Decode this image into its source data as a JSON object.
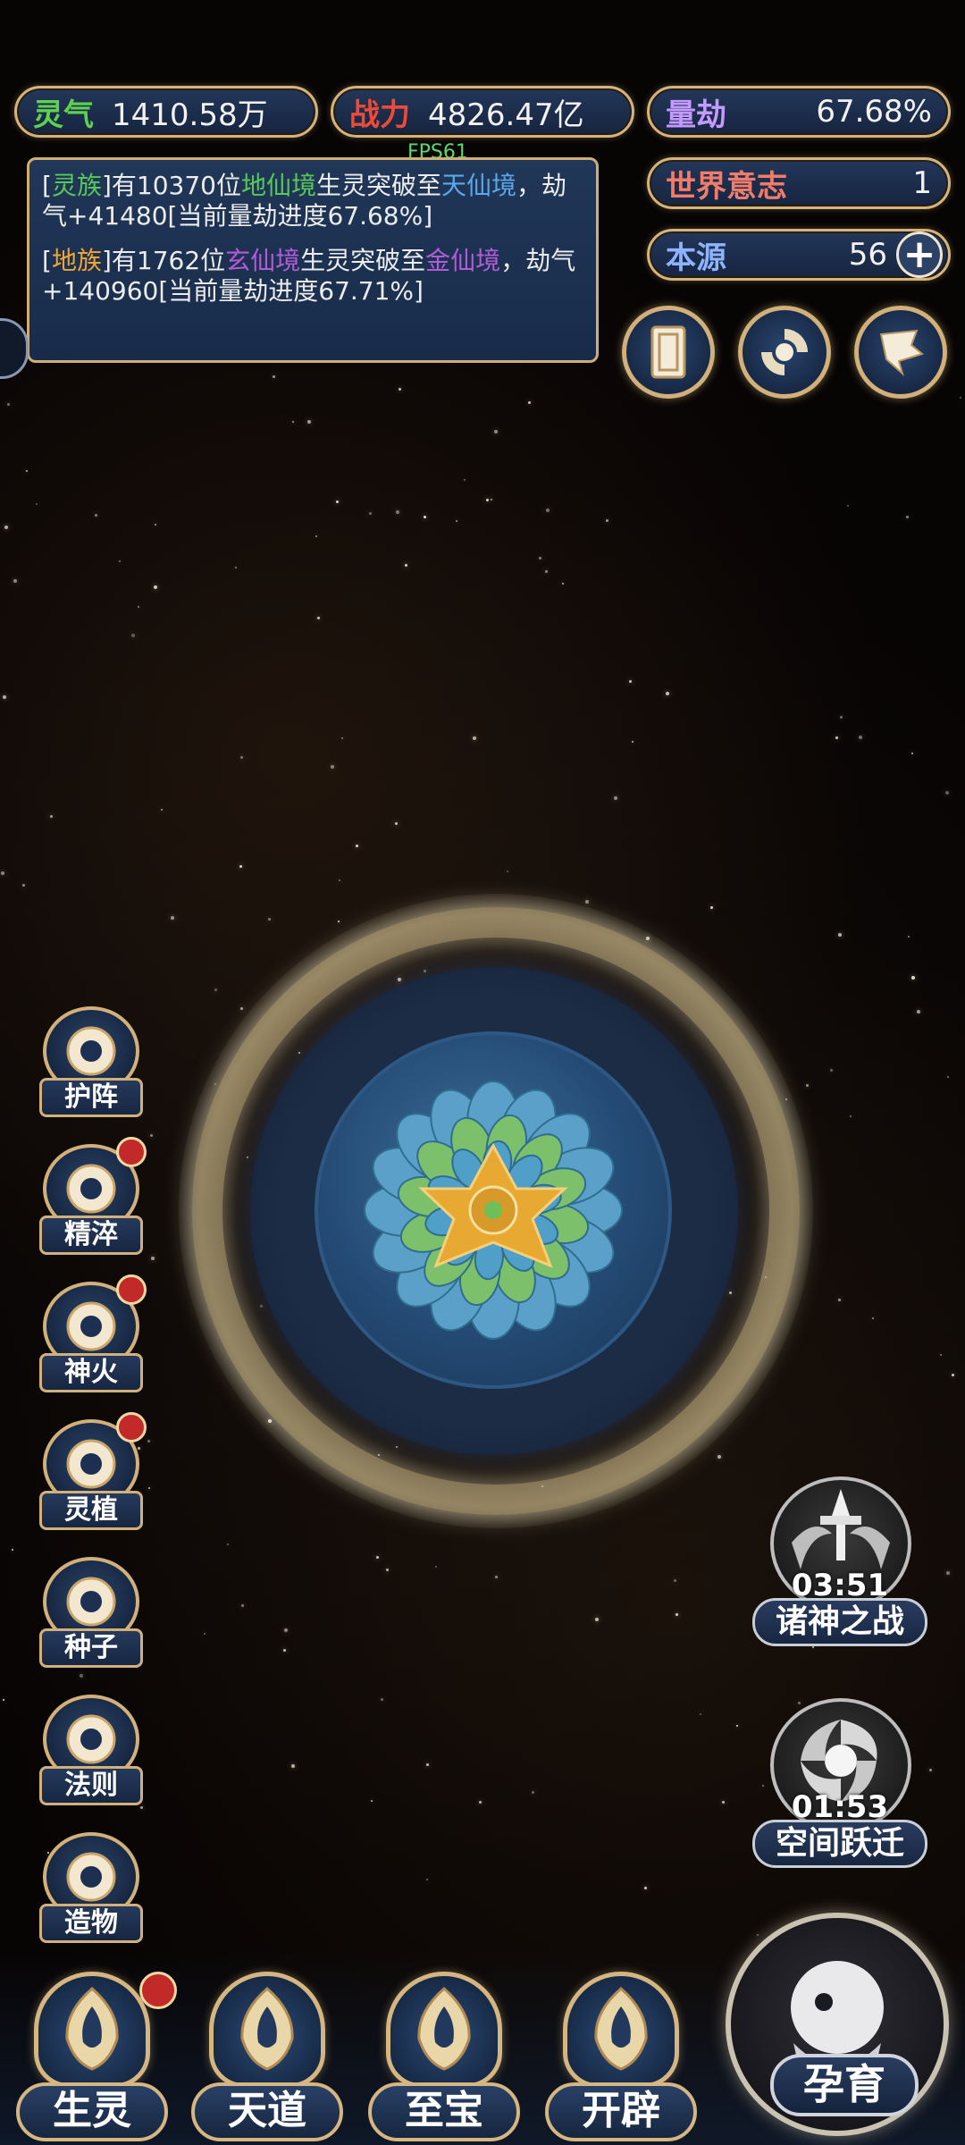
{
  "stats": {
    "lingqi_label": "灵气",
    "lingqi_value": "1410.58万",
    "zhanli_label": "战力",
    "zhanli_value": "4826.47亿",
    "liangjie_label": "量劫",
    "liangjie_value": "67.68%",
    "shijie_label": "世界意志",
    "shijie_value": "1",
    "benyuan_label": "本源",
    "benyuan_value": "56",
    "plus": "+"
  },
  "fps": "FPS61",
  "log": {
    "msg1": {
      "b1": "[",
      "race": "灵族",
      "b2": "]有10370位",
      "from": "地仙境",
      "mid": "生灵突破至",
      "to": "天仙境",
      "rest": "，劫气+41480[当前量劫进度67.68%]"
    },
    "msg2": {
      "b1": "[",
      "race": "地族",
      "b2": "]有1762位",
      "from": "玄仙境",
      "mid": "生灵突破至",
      "to": "金仙境",
      "rest": "，劫气+140960[当前量劫进度67.71%]"
    }
  },
  "top_icons": [
    "card-icon",
    "vortex-icon",
    "flag-icon"
  ],
  "left_menu": [
    {
      "label": "护阵",
      "icon": "taiji-icon",
      "badge": false
    },
    {
      "label": "精淬",
      "icon": "flame-lotus-icon",
      "badge": true
    },
    {
      "label": "神火",
      "icon": "fire-icon",
      "badge": true
    },
    {
      "label": "灵植",
      "icon": "plant-icon",
      "badge": true
    },
    {
      "label": "种子",
      "icon": "seed-icon",
      "badge": false
    },
    {
      "label": "法则",
      "icon": "rule-icon",
      "badge": false
    },
    {
      "label": "造物",
      "icon": "creation-icon",
      "badge": false
    }
  ],
  "events": [
    {
      "label": "诸神之战",
      "timer": "03:51"
    },
    {
      "label": "空间跃迁",
      "timer": "01:53"
    }
  ],
  "bottom_nav": [
    {
      "label": "生灵",
      "badge": true
    },
    {
      "label": "天道",
      "badge": false
    },
    {
      "label": "至宝",
      "badge": false
    },
    {
      "label": "开辟",
      "badge": false
    }
  ],
  "main_action": "孕育",
  "colors": {
    "gold": "#d4b47a",
    "panel": "#1a2d4c",
    "green": "#57c85a",
    "blue": "#5aa7ea",
    "orange": "#f0a534",
    "purple": "#b25bd9"
  }
}
